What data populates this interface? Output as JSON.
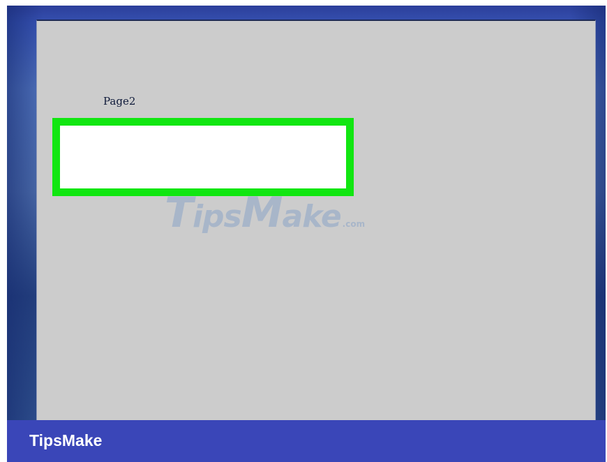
{
  "page": {
    "label": "Page2"
  },
  "watermark": {
    "part1": "T",
    "part2": "ips",
    "part3": "M",
    "part4": "ake",
    "suffix": ".com"
  },
  "footer": {
    "brand": "TipsMake"
  },
  "colors": {
    "textbox_border": "#11e611",
    "footer_bg": "#3a46b8",
    "page_bg": "#cccccc",
    "desktop_bg": "#4a6aa8"
  }
}
